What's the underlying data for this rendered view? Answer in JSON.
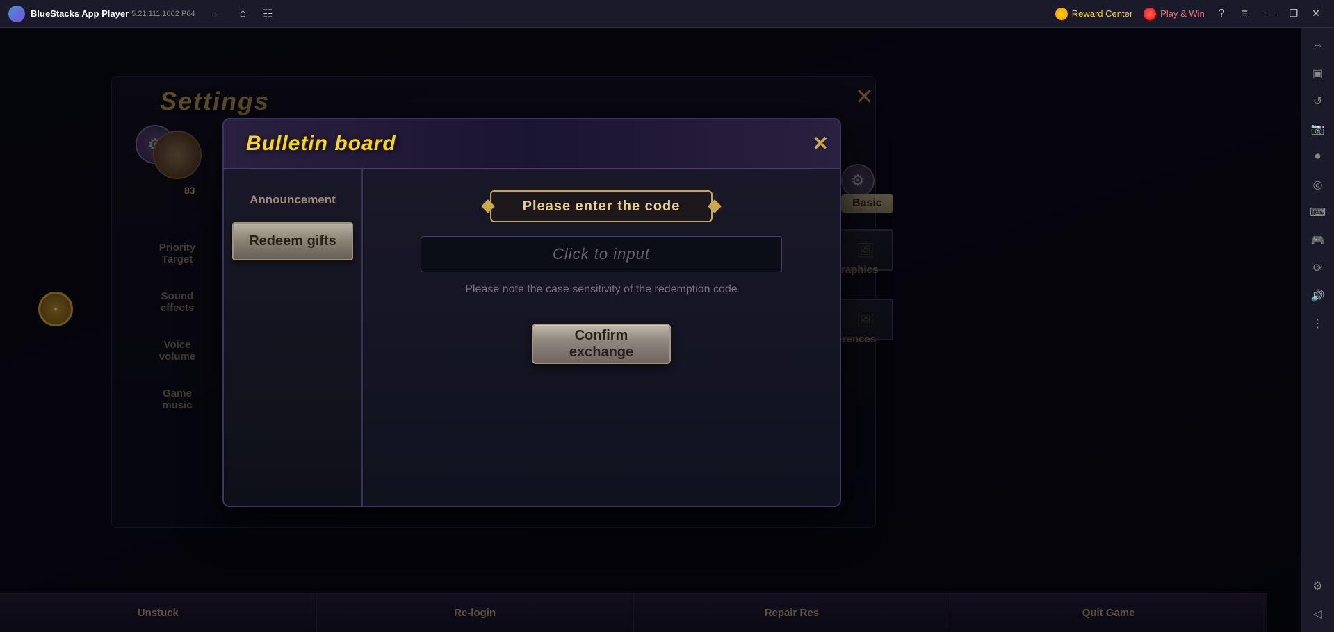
{
  "titlebar": {
    "app_name": "BlueStacks App Player",
    "version": "5.21.111.1002  P64",
    "nav": {
      "back": "←",
      "home": "⌂",
      "bookmark": "☷"
    },
    "reward_center": "Reward Center",
    "play_win": "Play & Win",
    "help": "?",
    "menu": "≡",
    "minimize": "—",
    "maximize": "❐",
    "close": "✕"
  },
  "settings": {
    "title": "Settings",
    "close": "✕",
    "menu_items": [
      {
        "label": "Priority\nTarget"
      },
      {
        "label": "Sound\neffects"
      },
      {
        "label": "Voice\nvolume"
      },
      {
        "label": "Game\nmusic"
      }
    ],
    "basic_label": "Basic",
    "graphics_label": "raphics",
    "references_label": "eferences"
  },
  "bulletin_modal": {
    "title": "Bulletin board",
    "close": "✕",
    "tabs": {
      "announcement": "Announcement",
      "redeem": "Redeem gifts"
    },
    "code_section": {
      "label": "Please enter the code",
      "input_placeholder": "Click to input",
      "note": "Please note the case sensitivity of the redemption code",
      "confirm_btn": "Confirm\nexchange"
    }
  },
  "bottom_bar": {
    "buttons": [
      "Unstuck",
      "Re-login",
      "Repair Res",
      "Quit Game"
    ]
  },
  "avatar": {
    "level": "83"
  }
}
